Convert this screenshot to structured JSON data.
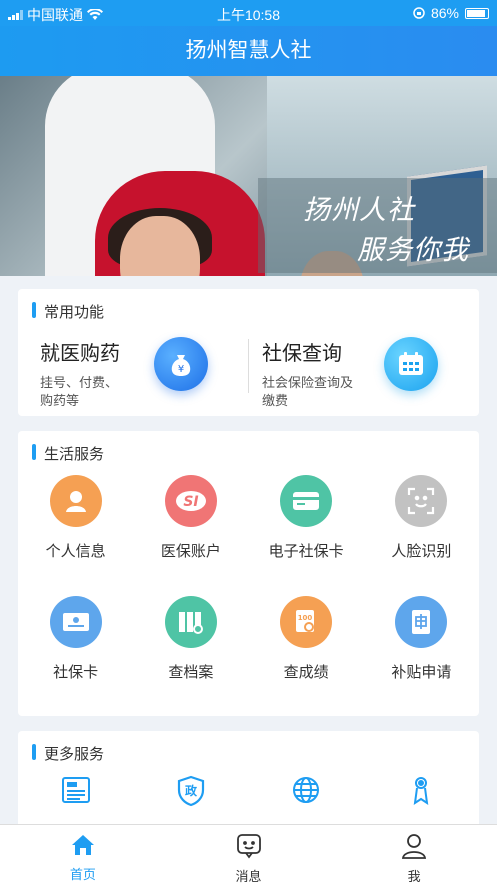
{
  "status": {
    "carrier": "中国联通",
    "time": "上午10:58",
    "battery": "86%"
  },
  "header": {
    "title": "扬州智慧人社"
  },
  "banner": {
    "line1": "扬州人社",
    "line2": "服务你我",
    "slides": 3,
    "active_slide": 2
  },
  "common": {
    "title": "常用功能",
    "items": [
      {
        "name": "就医购药",
        "desc1": "挂号、付费、",
        "desc2": "购药等",
        "icon": "money-bag-icon"
      },
      {
        "name": "社保查询",
        "desc1": "社会保险查询及",
        "desc2": "缴费",
        "icon": "calendar-icon"
      }
    ]
  },
  "life": {
    "title": "生活服务",
    "items": [
      {
        "label": "个人信息",
        "icon": "person-icon",
        "color": "#f5a053"
      },
      {
        "label": "医保账户",
        "icon": "si-icon",
        "color": "#f07575"
      },
      {
        "label": "电子社保卡",
        "icon": "card-icon",
        "color": "#4fc4a5"
      },
      {
        "label": "人脸识别",
        "icon": "face-scan-icon",
        "color": "#c2c2c2"
      },
      {
        "label": "社保卡",
        "icon": "id-card-icon",
        "color": "#5ea6ec"
      },
      {
        "label": "查档案",
        "icon": "archive-icon",
        "color": "#4fc4a5"
      },
      {
        "label": "查成绩",
        "icon": "score-icon",
        "color": "#f5a053"
      },
      {
        "label": "补贴申请",
        "icon": "apply-icon",
        "color": "#5ea6ec"
      }
    ]
  },
  "more": {
    "title": "更多服务",
    "items": [
      {
        "icon": "news-icon"
      },
      {
        "icon": "policy-shield-icon"
      },
      {
        "icon": "globe-icon"
      },
      {
        "icon": "medal-icon"
      }
    ]
  },
  "tabs": [
    {
      "label": "首页",
      "icon": "home-icon",
      "active": true
    },
    {
      "label": "消息",
      "icon": "message-icon",
      "active": false
    },
    {
      "label": "我",
      "icon": "user-icon",
      "active": false
    }
  ],
  "colors": {
    "accent": "#1e9df2"
  }
}
